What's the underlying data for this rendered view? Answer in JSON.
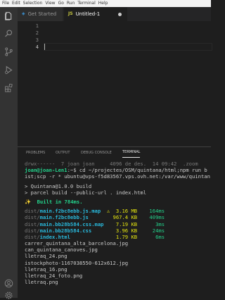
{
  "menu": [
    "File",
    "Edit",
    "Selection",
    "View",
    "Go",
    "Run",
    "Terminal",
    "Help"
  ],
  "tabs": [
    {
      "label": "Get Started",
      "icon": "vscode-icon",
      "active": false
    },
    {
      "label": "Untitled-1",
      "icon": "js-icon",
      "icon_text": "JS",
      "active": true,
      "dirty": true
    }
  ],
  "editor": {
    "line_numbers": [
      "1",
      "2",
      "3",
      "4"
    ],
    "current_line": 4
  },
  "activity_icons": [
    "explorer-icon",
    "search-icon",
    "source-control-icon",
    "run-debug-icon",
    "extensions-icon",
    "accounts-icon",
    "settings-gear-icon"
  ],
  "panel": {
    "tabs": [
      "PROBLEMS",
      "OUTPUT",
      "DEBUG CONSOLE",
      "TERMINAL"
    ],
    "active_tab": "TERMINAL"
  },
  "terminal": {
    "line1": "drwx------  7 joan joan     4096 de des.  14 09:42  .zoom",
    "prompt_user": "joan@joan-Len1",
    "prompt_rest": ":~$ cd ~/projectes/OSM/quintana/html;npm run b",
    "line3": "ist;scp -r * ubuntu@vps-f5d83567.vps.ovh.net:/var/www/quintan",
    "script_name": "> Quintana@1.0.0 build",
    "script_cmd": "> parcel build --public-url . index.html",
    "built": "Built in 784ms.",
    "build_icon": "✨",
    "dist_prefix": "dist/",
    "outputs": [
      {
        "file": "main.f2bc8ebb.js.map",
        "warn": "⚠",
        "size": "3.16 MB",
        "time": "164ms"
      },
      {
        "file": "main.f2bc8ebb.js",
        "warn": "",
        "size": "967.4 KB",
        "time": "409ms"
      },
      {
        "file": "main.bb28b584.css.map",
        "warn": "",
        "size": "7.19 KB",
        "time": "3ms"
      },
      {
        "file": "main.bb28b584.css",
        "warn": "",
        "size": "3.96 KB",
        "time": "24ms"
      },
      {
        "file": "index.html",
        "warn": "",
        "size": "1.79 KB",
        "time": "6ms"
      }
    ],
    "files": [
      "carrer_quintana_alta_barcelona.jpg",
      "can_quintana_canoves.jpg",
      "lletraq_24.png",
      "istockphoto-1167038550-612x612.jpg",
      "lletraq_16.png",
      "lletraq_24_foto.png",
      "lletraq.png"
    ]
  },
  "colors": {
    "accent": "#0e639c",
    "prompt_green": "#23d18b",
    "link_cyan": "#29b8db",
    "warn_yellow": "#e5e510"
  }
}
